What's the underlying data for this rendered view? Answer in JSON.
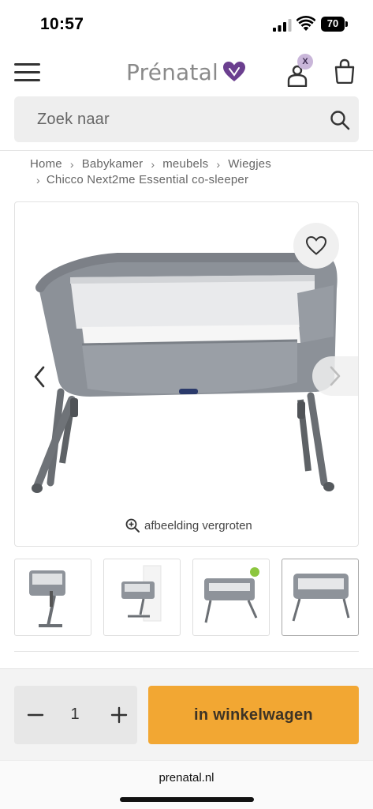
{
  "status_bar": {
    "time": "10:57",
    "battery": "70"
  },
  "header": {
    "logo_text": "Prénatal",
    "account_badge": "X"
  },
  "search": {
    "placeholder": "Zoek naar"
  },
  "breadcrumb": {
    "items": [
      "Home",
      "Babykamer",
      "meubels",
      "Wiegjes",
      "Chicco Next2me Essential co-sleeper"
    ],
    "separator": "›"
  },
  "gallery": {
    "zoom_label": "afbeelding vergroten",
    "thumbnails": [
      "thumb-1",
      "thumb-2",
      "thumb-3",
      "thumb-4"
    ],
    "active_thumbnail": 4
  },
  "cart": {
    "quantity": "1",
    "minus": "−",
    "plus": "+",
    "add_label": "in winkelwagen"
  },
  "browser": {
    "url": "prenatal.nl"
  },
  "colors": {
    "accent": "#f2a733",
    "brand_purple": "#6b3f8f",
    "badge": "#c9b6d9"
  }
}
